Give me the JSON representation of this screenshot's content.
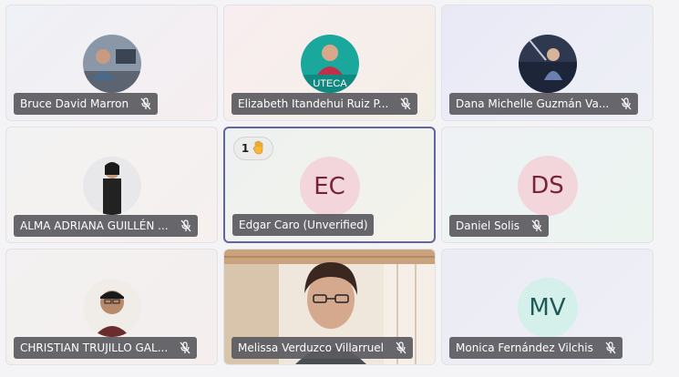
{
  "participants": [
    {
      "name": "Bruce David Marron",
      "muted": true
    },
    {
      "name": "Elizabeth Itandehui Ruiz P...",
      "muted": true,
      "avatar_text": "UTECA"
    },
    {
      "name": "Dana Michelle Guzmán Va...",
      "muted": true
    },
    {
      "name": "ALMA ADRIANA GUILLÉN ...",
      "muted": true
    },
    {
      "name": "Edgar Caro (Unverified)",
      "initials": "EC",
      "active_speaker": true,
      "raised_hand_count": "1"
    },
    {
      "name": "Daniel Solis",
      "muted": true,
      "initials": "DS"
    },
    {
      "name": "CHRISTIAN TRUJILLO GAL...",
      "muted": true
    },
    {
      "name": "Melissa Verduzco Villarruel",
      "muted": true,
      "video_on": true
    },
    {
      "name": "Monica Fernández Vilchis",
      "muted": true,
      "initials": "MV"
    }
  ],
  "colors": {
    "active_border": "#6264a7",
    "namebar_bg": "#5a5a5f",
    "initials_ec_bg": "#f3d6dc",
    "initials_ec_fg": "#7a2336",
    "initials_ds_bg": "#f3d6dc",
    "initials_ds_fg": "#7a2336",
    "initials_mv_bg": "#d5efea",
    "initials_mv_fg": "#1e5a57"
  },
  "icons": {
    "mic_off": "mic-off-icon",
    "raise_hand": "raised-hand-icon"
  }
}
